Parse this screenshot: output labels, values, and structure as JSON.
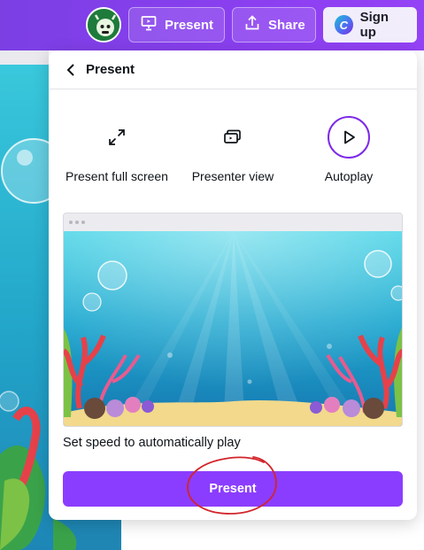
{
  "topbar": {
    "present_label": "Present",
    "share_label": "Share",
    "signup_label": "Sign up",
    "brand_letter": "C",
    "accent": "#8b3dff"
  },
  "panel": {
    "title": "Present",
    "options": [
      {
        "label": "Present full screen",
        "icon": "expand-arrows-icon"
      },
      {
        "label": "Presenter view",
        "icon": "presenter-view-icon"
      },
      {
        "label": "Autoplay",
        "icon": "play-icon",
        "selected": true
      }
    ],
    "speed_text": "Set speed to automatically play",
    "present_button": "Present"
  },
  "colors": {
    "topbar": "#8b3ff0",
    "primary_button": "#8b3dff",
    "annotation": "#d2242a"
  }
}
